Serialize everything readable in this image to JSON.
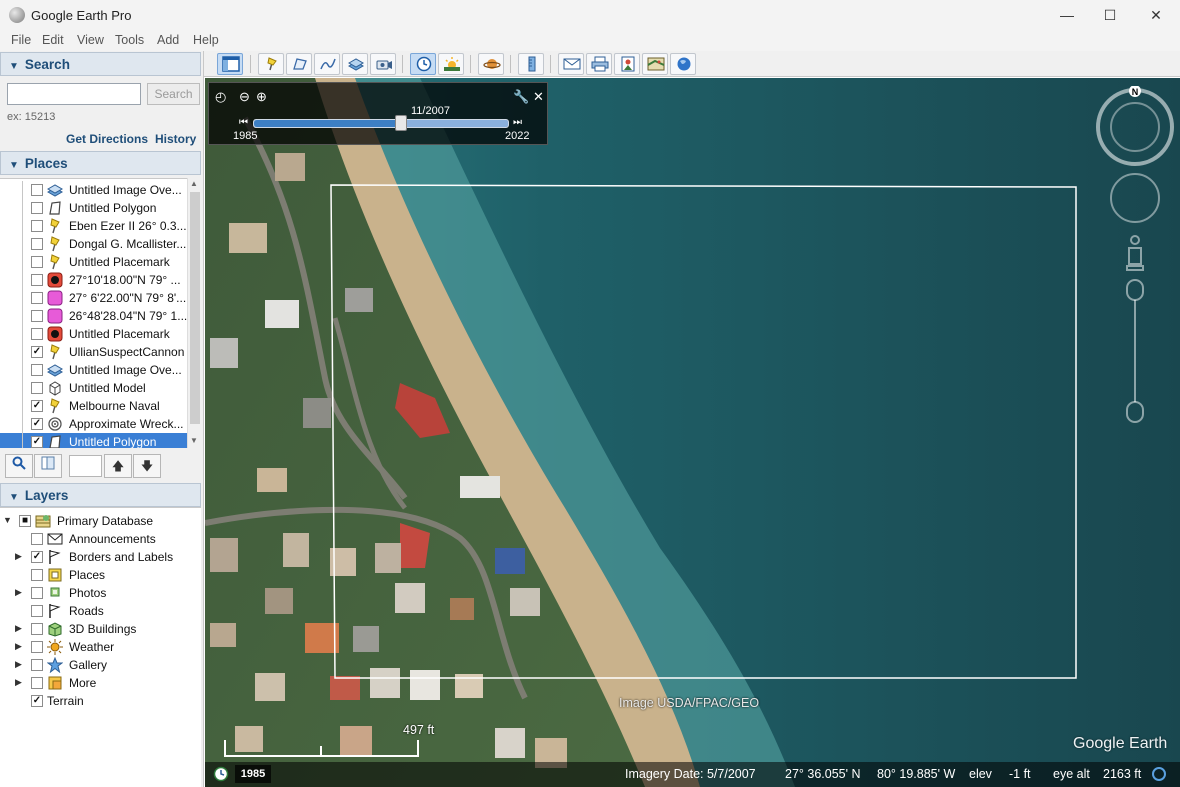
{
  "window": {
    "title": "Google Earth Pro",
    "minimize": "—",
    "maximize": "☐",
    "close": "✕"
  },
  "menu": [
    "File",
    "Edit",
    "View",
    "Tools",
    "Add",
    "Help"
  ],
  "search": {
    "header": "Search",
    "placeholder": "",
    "button": "Search",
    "example": "ex: 15213",
    "get_directions": "Get Directions",
    "history": "History"
  },
  "places": {
    "header": "Places",
    "items": [
      {
        "label": "Untitled Image Ove...",
        "checked": false,
        "icon": "image-overlay-icon"
      },
      {
        "label": "Untitled Polygon",
        "checked": false,
        "icon": "polygon-icon"
      },
      {
        "label": "Eben Ezer II   26° 0.3...",
        "checked": false,
        "icon": "placemark-pin-icon"
      },
      {
        "label": "Dongal G. Mcallister...",
        "checked": false,
        "icon": "placemark-pin-icon"
      },
      {
        "label": "Untitled Placemark",
        "checked": false,
        "icon": "placemark-pin-icon"
      },
      {
        "label": "27°10'18.00\"N   79° ...",
        "checked": false,
        "icon": "red-target-icon"
      },
      {
        "label": "27° 6'22.00\"N  79° 8'...",
        "checked": false,
        "icon": "pink-square-icon"
      },
      {
        "label": "26°48'28.04\"N  79° 1...",
        "checked": false,
        "icon": "pink-square-icon"
      },
      {
        "label": "Untitled Placemark",
        "checked": false,
        "icon": "red-target-icon"
      },
      {
        "label": "UllianSuspectCannon",
        "checked": true,
        "icon": "placemark-pin-icon"
      },
      {
        "label": "Untitled Image Ove...",
        "checked": false,
        "icon": "image-overlay-icon"
      },
      {
        "label": "Untitled Model",
        "checked": false,
        "icon": "model-icon"
      },
      {
        "label": "Melbourne Naval",
        "checked": true,
        "icon": "placemark-pin-icon"
      },
      {
        "label": "Approximate Wreck...",
        "checked": true,
        "icon": "ring-target-icon"
      },
      {
        "label": "Untitled Polygon",
        "checked": true,
        "icon": "polygon-icon",
        "selected": true
      }
    ]
  },
  "layers": {
    "header": "Layers",
    "items": [
      {
        "label": "Primary Database",
        "checked": "partial",
        "expand": "▼",
        "icon": "database-icon"
      },
      {
        "label": "Announcements",
        "checked": false,
        "expand": "",
        "icon": "envelope-icon"
      },
      {
        "label": "Borders and Labels",
        "checked": true,
        "expand": "▶",
        "icon": "flag-icon"
      },
      {
        "label": "Places",
        "checked": false,
        "expand": "",
        "icon": "places-square-icon"
      },
      {
        "label": "Photos",
        "checked": false,
        "expand": "▶",
        "icon": "photo-icon"
      },
      {
        "label": "Roads",
        "checked": false,
        "expand": "",
        "icon": "roads-icon"
      },
      {
        "label": "3D Buildings",
        "checked": false,
        "expand": "▶",
        "icon": "building-icon"
      },
      {
        "label": "Weather",
        "checked": false,
        "expand": "▶",
        "icon": "sun-icon"
      },
      {
        "label": "Gallery",
        "checked": false,
        "expand": "▶",
        "icon": "star-icon"
      },
      {
        "label": "More",
        "checked": false,
        "expand": "▶",
        "icon": "more-icon"
      },
      {
        "label": "Terrain",
        "checked": true,
        "expand": "",
        "icon": ""
      }
    ]
  },
  "time_slider": {
    "date": "11/2007",
    "start_year": "1985",
    "end_year": "2022",
    "position": 0.58
  },
  "map": {
    "attribution": "Image USDA/FPAC/GEO",
    "scale_label": "497 ft",
    "historical_year": "1985",
    "logo": "Google Earth",
    "compass_label": "N"
  },
  "status": {
    "imagery_date": "Imagery Date: 5/7/2007",
    "lat": "27° 36.055' N",
    "lon": "80° 19.885' W",
    "elev_label": "elev",
    "elev_value": "-1 ft",
    "eye_label": "eye alt",
    "eye_value": "2163 ft"
  },
  "colors": {
    "selection": "#3a7fd5",
    "header_text": "#1f4e79",
    "ocean": "#1d5560"
  }
}
